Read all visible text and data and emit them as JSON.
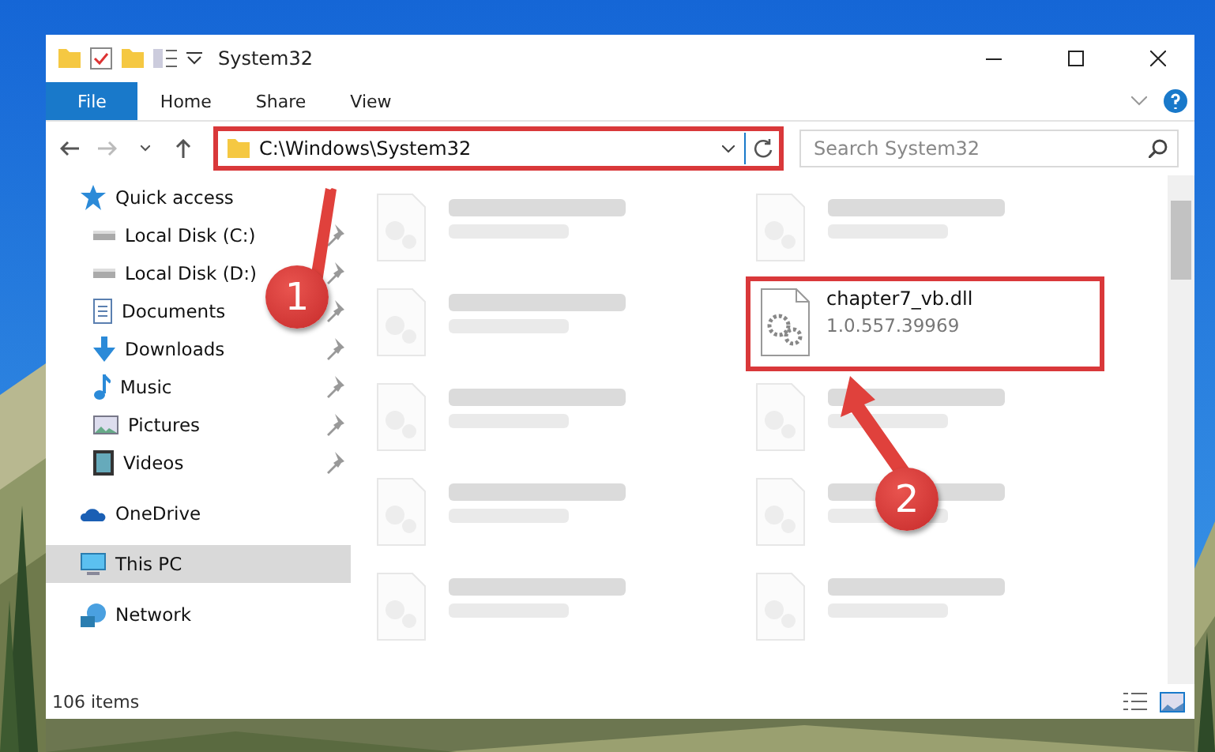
{
  "window": {
    "title": "System32"
  },
  "ribbon": {
    "tabs": [
      {
        "label": "File",
        "selected": true
      },
      {
        "label": "Home",
        "selected": false
      },
      {
        "label": "Share",
        "selected": false
      },
      {
        "label": "View",
        "selected": false
      }
    ]
  },
  "address_bar": {
    "path": "C:\\Windows\\System32",
    "highlighted": true,
    "search_placeholder": "Search System32"
  },
  "sidebar": {
    "items": [
      {
        "label": "Quick access",
        "kind": "star",
        "selected": false,
        "children": [
          {
            "label": "Local Disk (C:)",
            "kind": "drive",
            "pinned": true
          },
          {
            "label": "Local Disk (D:)",
            "kind": "drive",
            "pinned": true
          },
          {
            "label": "Documents",
            "kind": "document",
            "pinned": true
          },
          {
            "label": "Downloads",
            "kind": "download",
            "pinned": true
          },
          {
            "label": "Music",
            "kind": "music",
            "pinned": true
          },
          {
            "label": "Pictures",
            "kind": "pictures",
            "pinned": true
          },
          {
            "label": "Videos",
            "kind": "videos",
            "pinned": true
          }
        ]
      },
      {
        "label": "OneDrive",
        "kind": "cloud",
        "selected": false
      },
      {
        "label": "This PC",
        "kind": "monitor",
        "selected": true
      },
      {
        "label": "Network",
        "kind": "network",
        "selected": false
      }
    ]
  },
  "files": [
    {
      "kind": "blurred"
    },
    {
      "kind": "blurred"
    },
    {
      "kind": "blurred"
    },
    {
      "kind": "file",
      "name": "chapter7_vb.dll",
      "detail": "1.0.557.39969",
      "highlighted": true
    },
    {
      "kind": "blurred"
    },
    {
      "kind": "blurred"
    },
    {
      "kind": "blurred"
    },
    {
      "kind": "blurred"
    },
    {
      "kind": "blurred"
    },
    {
      "kind": "blurred"
    }
  ],
  "status_bar": {
    "count": "106 items"
  },
  "annotations": [
    {
      "number": "1"
    },
    {
      "number": "2"
    }
  ]
}
